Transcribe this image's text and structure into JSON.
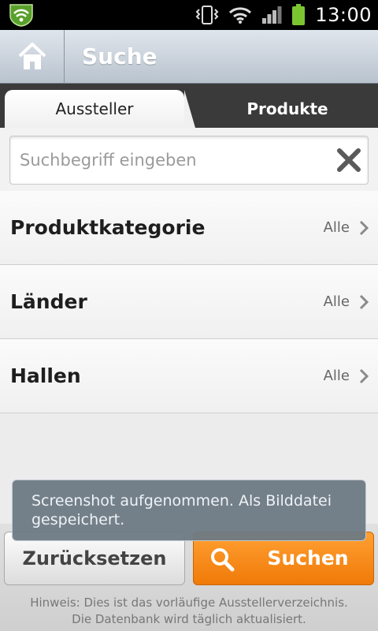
{
  "status_bar": {
    "time": "13:00",
    "icons": [
      "lookout-shield-icon",
      "vibrate-icon",
      "wifi-icon",
      "signal-icon",
      "battery-icon"
    ]
  },
  "title_bar": {
    "title": "Suche",
    "home_icon": "home-icon"
  },
  "tabs": [
    {
      "label": "Aussteller",
      "active": true
    },
    {
      "label": "Produkte",
      "active": false
    }
  ],
  "search": {
    "placeholder": "Suchbegriff eingeben",
    "value": "",
    "clear_icon": "close-icon"
  },
  "filters": [
    {
      "label": "Produktkategorie",
      "value": "Alle"
    },
    {
      "label": "Länder",
      "value": "Alle"
    },
    {
      "label": "Hallen",
      "value": "Alle"
    }
  ],
  "toast": {
    "line1": "Screenshot aufgenommen. Als Bilddatei",
    "line2": "gespeichert."
  },
  "footer": {
    "reset_label": "Zurücksetzen",
    "search_label": "Suchen",
    "hint_line1": "Hinweis: Dies ist das vorläufige Ausstellerverzeichnis.",
    "hint_line2": "Die Datenbank wird täglich aktualisiert."
  },
  "colors": {
    "accent_orange": "#f07a08",
    "status_green": "#7cc532",
    "tab_bar": "#3a3a3a"
  }
}
